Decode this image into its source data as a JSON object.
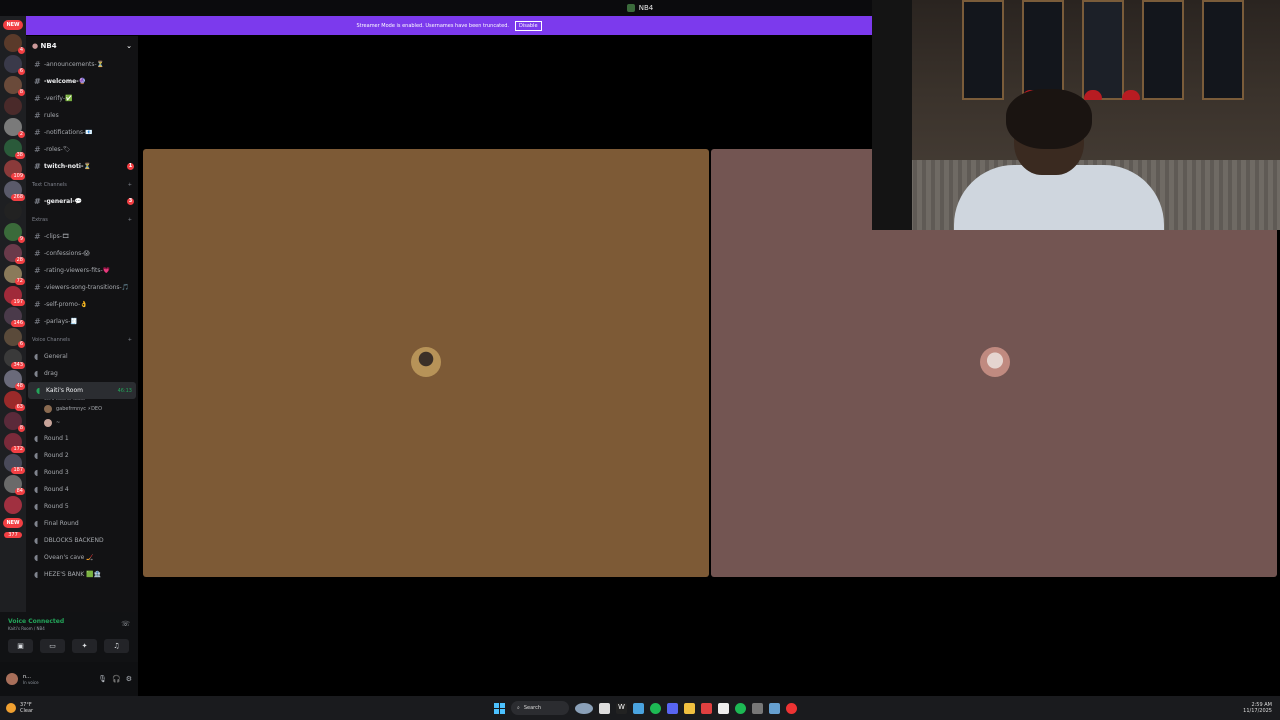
{
  "window": {
    "title": "NB4"
  },
  "banner": {
    "text": "Streamer Mode is enabled. Usernames have been truncated.",
    "disable_label": "Disable"
  },
  "server": {
    "name": "NB4"
  },
  "channels_top": [
    {
      "label": "-announcements-⏳",
      "unread": false
    },
    {
      "label": "-welcome-🔮",
      "unread": true
    },
    {
      "label": "-verify-✅",
      "unread": false
    },
    {
      "label": "rules",
      "unread": false,
      "icon": "rules"
    },
    {
      "label": "-notifications-📧",
      "unread": false
    },
    {
      "label": "-roles-🏷",
      "unread": false
    },
    {
      "label": "twitch-noti-⏳",
      "unread": true,
      "count": "1"
    }
  ],
  "categories": {
    "text": "Text Channels",
    "extras": "Extras",
    "voice": "Voice Channels"
  },
  "text_channels": [
    {
      "label": "-general-💬",
      "unread": true,
      "count": "3"
    }
  ],
  "extras_channels": [
    {
      "label": "-clips-🎞"
    },
    {
      "label": "-confessions-😱"
    },
    {
      "label": "-rating-viewers-fits-💗"
    },
    {
      "label": "-viewers-song-transitions-🎵"
    },
    {
      "label": "-self-promo-👌"
    },
    {
      "label": "-parlays-🧾"
    }
  ],
  "voice_channels_a": [
    {
      "label": "General"
    },
    {
      "label": "drag"
    }
  ],
  "active_voice": {
    "label": "Kaiti's Room",
    "timer": "46:13",
    "status": "Set a channel status",
    "users": [
      "gabefrmnyc ⚡DEO",
      "~"
    ]
  },
  "voice_channels_b": [
    {
      "label": "Round 1"
    },
    {
      "label": "Round 2"
    },
    {
      "label": "Round 3"
    },
    {
      "label": "Round 4"
    },
    {
      "label": "Round 5"
    },
    {
      "label": "Final Round"
    },
    {
      "label": "DBLOCKS BACKEND"
    },
    {
      "label": "Ovean's cave 🏒"
    },
    {
      "label": "HEZE'S BANK 🟩🏦"
    }
  ],
  "guild_badges": {
    "new_top": "NEW",
    "new_bottom": "NEW",
    "bottom_count": "377"
  },
  "voice_status": {
    "connected": "Voice Connected",
    "location": "Kaiti's Room / NB4"
  },
  "user": {
    "name": "n...",
    "status": "In voice"
  },
  "taskbar": {
    "temp": "37°F",
    "cond": "Clear",
    "search": "Search",
    "time": "2:59 AM",
    "date": "11/17/2025"
  },
  "colors": {
    "banner": "#7c3aed",
    "tile_left": "#7d5a36",
    "tile_right": "#735552",
    "online": "#23a55a"
  }
}
